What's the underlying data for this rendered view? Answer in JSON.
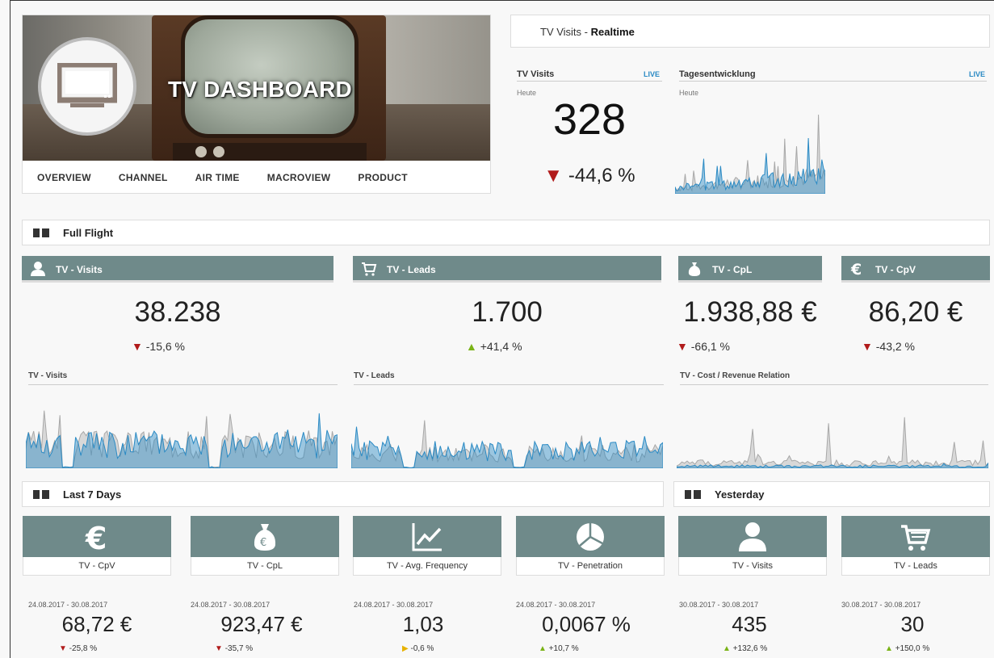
{
  "hero": {
    "title": "TV DASHBOARD",
    "nav": [
      "OVERVIEW",
      "CHANNEL",
      "AIR TIME",
      "MACROVIEW",
      "PRODUCT"
    ]
  },
  "realtime": {
    "header_prefix": "TV Visits - ",
    "header_bold": "Realtime",
    "visits_title": "TV Visits",
    "trend_title": "Tagesentwicklung",
    "live_label": "LIVE",
    "period_label": "Heute",
    "value": "328",
    "delta": "-44,6 %",
    "delta_direction": "down"
  },
  "full_flight": {
    "title": "Full Flight",
    "kpis": [
      {
        "label": "TV - Visits",
        "icon": "user-icon",
        "value": "38.238",
        "delta": "-15,6 %",
        "direction": "down"
      },
      {
        "label": "TV - Leads",
        "icon": "cart-icon",
        "value": "1.700",
        "delta": "+41,4 %",
        "direction": "up"
      },
      {
        "label": "TV - CpL",
        "icon": "money-bag-icon",
        "value": "1.938,88 €",
        "delta": "-66,1 %",
        "direction": "down"
      },
      {
        "label": "TV - CpV",
        "icon": "euro-icon",
        "value": "86,20 €",
        "delta": "-43,2 %",
        "direction": "down"
      }
    ],
    "charts": [
      {
        "label": "TV - Visits"
      },
      {
        "label": "TV - Leads"
      },
      {
        "label": "TV - Cost / Revenue Relation"
      }
    ]
  },
  "last7": {
    "title": "Last 7 Days",
    "tiles": [
      {
        "label": "TV - CpV",
        "icon": "euro-icon",
        "date": "24.08.2017 - 30.08.2017",
        "value": "68,72 €",
        "delta": "-25,8 %",
        "direction": "down"
      },
      {
        "label": "TV - CpL",
        "icon": "money-bag-icon",
        "date": "24.08.2017 - 30.08.2017",
        "value": "923,47 €",
        "delta": "-35,7 %",
        "direction": "down"
      },
      {
        "label": "TV - Avg. Frequency",
        "icon": "line-chart-icon",
        "date": "24.08.2017 - 30.08.2017",
        "value": "1,03",
        "delta": "-0,6 %",
        "direction": "flat"
      },
      {
        "label": "TV - Penetration",
        "icon": "pie-chart-icon",
        "date": "24.08.2017 - 30.08.2017",
        "value": "0,0067 %",
        "delta": "+10,7 %",
        "direction": "up"
      }
    ]
  },
  "yesterday": {
    "title": "Yesterday",
    "tiles": [
      {
        "label": "TV - Visits",
        "icon": "user-icon",
        "date": "30.08.2017 - 30.08.2017",
        "value": "435",
        "delta": "+132,6 %",
        "direction": "up"
      },
      {
        "label": "TV - Leads",
        "icon": "cart-icon",
        "date": "30.08.2017 - 30.08.2017",
        "value": "30",
        "delta": "+150,0 %",
        "direction": "up"
      }
    ]
  },
  "colors": {
    "tile": "#6f8a8a",
    "series_blue": "#2a8ac4",
    "series_grey": "#bdbdbd",
    "down": "#b11b1b",
    "up": "#7ab317",
    "flat": "#e7b200"
  }
}
